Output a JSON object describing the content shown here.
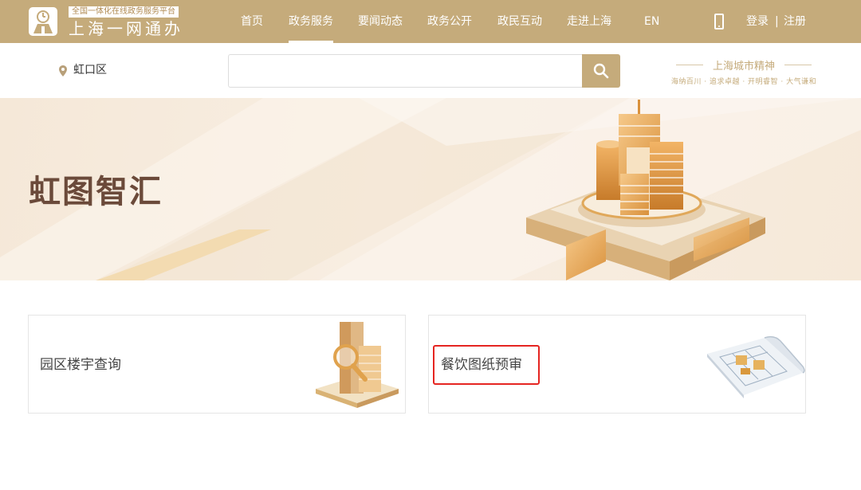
{
  "header": {
    "logo_sub": "全国一体化在线政务服务平台",
    "logo_main": "上海一网通办",
    "nav": [
      {
        "label": "首页",
        "active": false
      },
      {
        "label": "政务服务",
        "active": true
      },
      {
        "label": "要闻动态",
        "active": false
      },
      {
        "label": "政务公开",
        "active": false
      },
      {
        "label": "政民互动",
        "active": false
      },
      {
        "label": "走进上海",
        "active": false
      },
      {
        "label": "EN",
        "active": false
      }
    ],
    "login": "登录",
    "separator": "|",
    "register": "注册",
    "icons": {
      "phone": "mobile-phone-icon",
      "logo": "logo-emblem-icon"
    }
  },
  "search_row": {
    "location": "虹口区",
    "location_icon": "map-pin-icon",
    "search_placeholder": "",
    "search_icon": "search-icon",
    "spirit_title": "上海城市精神",
    "spirit_sub": "海纳百川 · 追求卓越 · 开明睿智 · 大气谦和"
  },
  "banner": {
    "title": "虹图智汇"
  },
  "cards": [
    {
      "label": "园区楼宇查询",
      "icon": "building-magnifier-icon"
    },
    {
      "label": "餐饮图纸预审",
      "icon": "blueprint-icon",
      "highlighted": true
    }
  ],
  "colors": {
    "brand": "#c5ab7b",
    "banner_title": "#6b4a3a",
    "highlight": "#e52521"
  }
}
